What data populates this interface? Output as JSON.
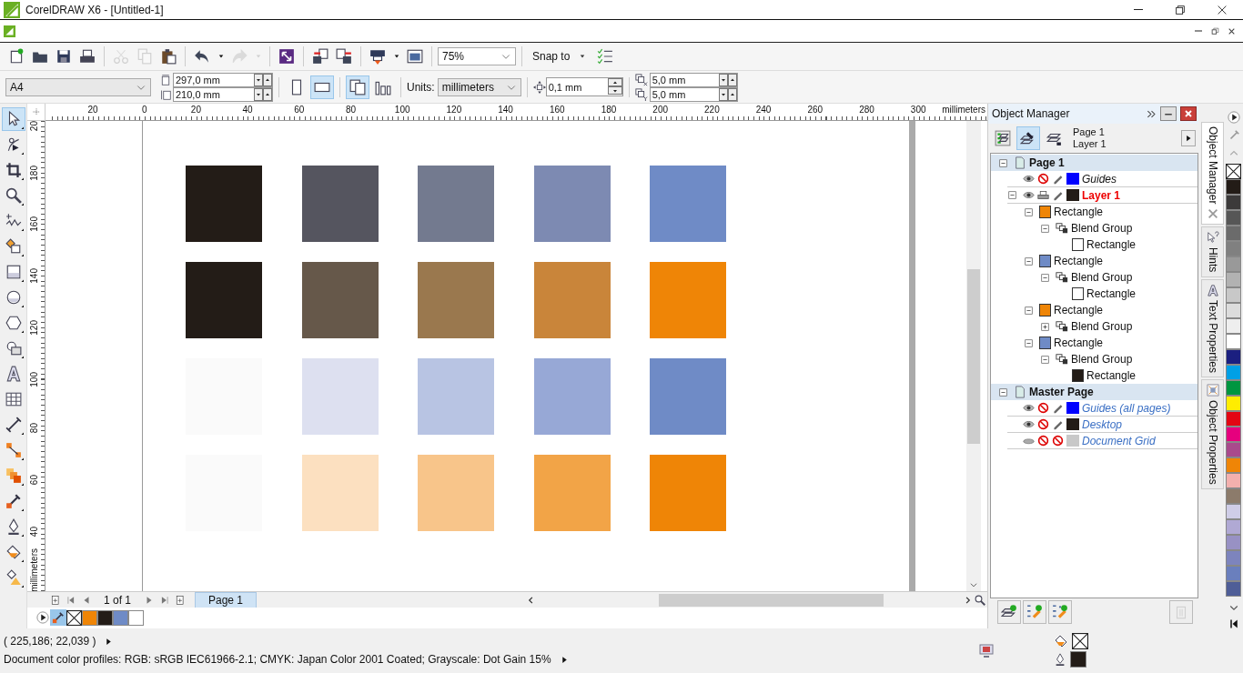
{
  "window": {
    "title": "CorelDRAW X6 - [Untitled-1]"
  },
  "standard_toolbar": {
    "groups": [
      [
        {
          "kind": "new",
          "disabled": false
        },
        {
          "kind": "open",
          "disabled": false
        },
        {
          "kind": "save",
          "disabled": false
        },
        {
          "kind": "print",
          "disabled": false
        }
      ],
      [
        {
          "kind": "cut",
          "disabled": true
        },
        {
          "kind": "copy",
          "disabled": true
        },
        {
          "kind": "paste",
          "disabled": false
        }
      ],
      [
        {
          "kind": "undo",
          "disabled": false
        },
        {
          "kind": "dropdown",
          "disabled": false
        },
        {
          "kind": "redo",
          "disabled": true
        },
        {
          "kind": "dropdown",
          "disabled": true
        }
      ],
      [
        {
          "kind": "launch",
          "disabled": false
        }
      ],
      [
        {
          "kind": "import",
          "disabled": false
        },
        {
          "kind": "export",
          "disabled": false
        }
      ],
      [
        {
          "kind": "publish",
          "disabled": false
        },
        {
          "kind": "dropdown",
          "disabled": false
        },
        {
          "kind": "view",
          "disabled": false
        }
      ],
      [
        {
          "kind": "combo",
          "value": "75%"
        }
      ],
      [
        {
          "kind": "menu",
          "label": "Snap to"
        },
        {
          "kind": "snap-options",
          "disabled": false
        }
      ]
    ]
  },
  "property_bar": {
    "paper": "A4",
    "width": "297,0 mm",
    "height": "210,0 mm",
    "orientation": [
      {
        "kind": "portrait",
        "selected": false
      },
      {
        "kind": "landscape",
        "selected": true
      }
    ],
    "page_scope": [
      {
        "kind": "all-pages",
        "selected": true
      },
      {
        "kind": "current-page",
        "selected": false
      }
    ],
    "units_label": "Units:",
    "units": "millimeters",
    "nudge": "0,1 mm",
    "duplicate_x": "5,0 mm",
    "duplicate_y": "5,0 mm"
  },
  "toolbox": [
    {
      "kind": "pick",
      "selected": true,
      "flyout": true
    },
    {
      "kind": "shape",
      "selected": false,
      "flyout": true
    },
    {
      "kind": "crop",
      "selected": false,
      "flyout": true
    },
    {
      "kind": "zoom",
      "selected": false,
      "flyout": true
    },
    {
      "kind": "freehand",
      "selected": false,
      "flyout": true
    },
    {
      "kind": "smartfill",
      "selected": false,
      "flyout": true
    },
    {
      "kind": "rectangle",
      "selected": false,
      "flyout": true
    },
    {
      "kind": "ellipse",
      "selected": false,
      "flyout": true
    },
    {
      "kind": "polygon",
      "selected": false,
      "flyout": true
    },
    {
      "kind": "shapes",
      "selected": false,
      "flyout": true
    },
    {
      "kind": "text",
      "selected": false,
      "flyout": false
    },
    {
      "kind": "table",
      "selected": false,
      "flyout": false
    },
    {
      "kind": "dimension",
      "selected": false,
      "flyout": true
    },
    {
      "kind": "connector",
      "selected": false,
      "flyout": true
    },
    {
      "kind": "blend",
      "selected": false,
      "flyout": true
    },
    {
      "kind": "eyedropper",
      "selected": false,
      "flyout": true
    },
    {
      "kind": "outline",
      "selected": false,
      "flyout": true
    },
    {
      "kind": "fill",
      "selected": false,
      "flyout": true
    },
    {
      "kind": "interactive-fill",
      "selected": false,
      "flyout": true
    }
  ],
  "rulers": {
    "horizontal": [
      "20",
      "0",
      "20",
      "40",
      "60",
      "80",
      "100",
      "120",
      "140",
      "160",
      "180",
      "200",
      "220",
      "240",
      "260",
      "280",
      "300"
    ],
    "horizontal_unit": "millimeters",
    "vertical": [
      "20",
      "180",
      "160",
      "140",
      "120",
      "100",
      "80",
      "60",
      "40"
    ],
    "vertical_unit": "millimeters"
  },
  "canvas": {
    "shapes": [
      {
        "color": "#231c17"
      },
      {
        "color": "#55555f"
      },
      {
        "color": "#737a8f"
      },
      {
        "color": "#7d8ab2"
      },
      {
        "color": "#6f8bc6"
      },
      {
        "color": "#231c17"
      },
      {
        "color": "#66584a"
      },
      {
        "color": "#9a784e"
      },
      {
        "color": "#c9853a"
      },
      {
        "color": "#ef8506"
      },
      {
        "color": "#fafafa"
      },
      {
        "color": "#dde0f0"
      },
      {
        "color": "#b8c4e3"
      },
      {
        "color": "#97a8d6"
      },
      {
        "color": "#6f8bc6"
      },
      {
        "color": "#fafafa"
      },
      {
        "color": "#fce0c0"
      },
      {
        "color": "#f8c58a"
      },
      {
        "color": "#f2a447"
      },
      {
        "color": "#ef8506"
      }
    ]
  },
  "page_navigator": {
    "position": "1 of 1",
    "tabs": [
      {
        "label": "Page 1",
        "selected": true
      }
    ]
  },
  "document_palette": [
    {
      "kind": "none"
    },
    {
      "kind": "color",
      "color": "#ef8506"
    },
    {
      "kind": "color",
      "color": "#231c17"
    },
    {
      "kind": "color",
      "color": "#6f8bc6"
    },
    {
      "kind": "color",
      "color": "#ffffff"
    }
  ],
  "object_manager": {
    "title": "Object Manager",
    "current_page": "Page 1",
    "current_layer": "Layer 1",
    "view_buttons": [
      {
        "kind": "properties",
        "selected": false
      },
      {
        "kind": "edit-across",
        "selected": true
      },
      {
        "kind": "layer-view",
        "selected": false
      }
    ],
    "tree": [
      {
        "kind": "page",
        "label": "Page 1",
        "expanded": true,
        "children": [
          {
            "kind": "layer",
            "label": "Guides",
            "current": false,
            "visible": true,
            "printable": false,
            "editable": true,
            "color": "#0000ff"
          },
          {
            "kind": "layer",
            "label": "Layer 1",
            "current": true,
            "visible": true,
            "printable": true,
            "editable": true,
            "color": "#231c17",
            "expanded": true,
            "children": [
              {
                "kind": "rectangle",
                "label": "Rectangle",
                "color": "#ef8506",
                "expanded": true,
                "children": [
                  {
                    "kind": "blend-group",
                    "label": "Blend Group",
                    "expanded": true,
                    "children": [
                      {
                        "kind": "rectangle",
                        "label": "Rectangle",
                        "color": "#ffffff"
                      }
                    ]
                  }
                ]
              },
              {
                "kind": "rectangle",
                "label": "Rectangle",
                "color": "#6f8bc6",
                "expanded": true,
                "children": [
                  {
                    "kind": "blend-group",
                    "label": "Blend Group",
                    "expanded": true,
                    "children": [
                      {
                        "kind": "rectangle",
                        "label": "Rectangle",
                        "color": "#ffffff"
                      }
                    ]
                  }
                ]
              },
              {
                "kind": "rectangle",
                "label": "Rectangle",
                "color": "#ef8506",
                "expanded": true,
                "children": [
                  {
                    "kind": "blend-group",
                    "label": "Blend Group",
                    "expanded": false
                  }
                ]
              },
              {
                "kind": "rectangle",
                "label": "Rectangle",
                "color": "#6f8bc6",
                "expanded": true,
                "children": [
                  {
                    "kind": "blend-group",
                    "label": "Blend Group",
                    "expanded": true,
                    "children": [
                      {
                        "kind": "rectangle",
                        "label": "Rectangle",
                        "color": "#231c17"
                      }
                    ]
                  }
                ]
              }
            ]
          }
        ]
      },
      {
        "kind": "page",
        "label": "Master Page",
        "expanded": true,
        "children": [
          {
            "kind": "master-layer",
            "label": "Guides (all pages)",
            "current": false,
            "visible": true,
            "printable": false,
            "editable": true,
            "color": "#0000ff"
          },
          {
            "kind": "master-layer",
            "label": "Desktop",
            "current": false,
            "visible": true,
            "printable": false,
            "editable": true,
            "color": "#231c17"
          },
          {
            "kind": "master-layer",
            "label": "Document Grid",
            "current": false,
            "visible": false,
            "printable": false,
            "editable": false,
            "color": "#c8c8c8"
          }
        ]
      }
    ],
    "bottom_buttons": [
      {
        "kind": "new-layer",
        "disabled": false
      },
      {
        "kind": "new-master-layer",
        "disabled": false
      },
      {
        "kind": "new-master-layer-odd",
        "disabled": false
      },
      {
        "kind": "delete",
        "disabled": true
      }
    ]
  },
  "docker_tabs": [
    {
      "kind": "object-manager",
      "label": "Object Manager",
      "selected": true
    },
    {
      "kind": "hints",
      "label": "Hints",
      "selected": false
    },
    {
      "kind": "text-properties",
      "label": "Text Properties",
      "selected": false
    },
    {
      "kind": "object-properties",
      "label": "Object Properties",
      "selected": false
    }
  ],
  "color_palette": [
    {
      "kind": "none"
    },
    {
      "kind": "color",
      "color": "#231c17"
    },
    {
      "kind": "color",
      "color": "#3c3a3a"
    },
    {
      "kind": "color",
      "color": "#565656"
    },
    {
      "kind": "color",
      "color": "#6b6b6b"
    },
    {
      "kind": "color",
      "color": "#808080"
    },
    {
      "kind": "color",
      "color": "#999999"
    },
    {
      "kind": "color",
      "color": "#b2b2b2"
    },
    {
      "kind": "color",
      "color": "#c8c8c8"
    },
    {
      "kind": "color",
      "color": "#dcdcdc"
    },
    {
      "kind": "color",
      "color": "#eeeeee"
    },
    {
      "kind": "color",
      "color": "#ffffff"
    },
    {
      "kind": "color",
      "color": "#1b1f80"
    },
    {
      "kind": "color",
      "color": "#00a0e6"
    },
    {
      "kind": "color",
      "color": "#009640"
    },
    {
      "kind": "color",
      "color": "#ffed00"
    },
    {
      "kind": "color",
      "color": "#e30613"
    },
    {
      "kind": "color",
      "color": "#e6007e"
    },
    {
      "kind": "color",
      "color": "#a94a8c"
    },
    {
      "kind": "color",
      "color": "#ef8506"
    },
    {
      "kind": "color",
      "color": "#f3b0ae"
    },
    {
      "kind": "color",
      "color": "#8c7b6b"
    },
    {
      "kind": "color",
      "color": "#cfcde7"
    },
    {
      "kind": "color",
      "color": "#b0a9d4"
    },
    {
      "kind": "color",
      "color": "#9891c4"
    },
    {
      "kind": "color",
      "color": "#7d84bd"
    },
    {
      "kind": "color",
      "color": "#6a7fbd"
    },
    {
      "kind": "color",
      "color": "#4f5e97"
    }
  ],
  "status_bar": {
    "coordinates": "( 225,186; 22,039 )",
    "color_profiles": "Document color profiles: RGB: sRGB IEC61966-2.1; CMYK: Japan Color 2001 Coated; Grayscale: Dot Gain 15%",
    "fill": {
      "kind": "none"
    },
    "outline": {
      "kind": "color",
      "color": "#231c17"
    }
  }
}
